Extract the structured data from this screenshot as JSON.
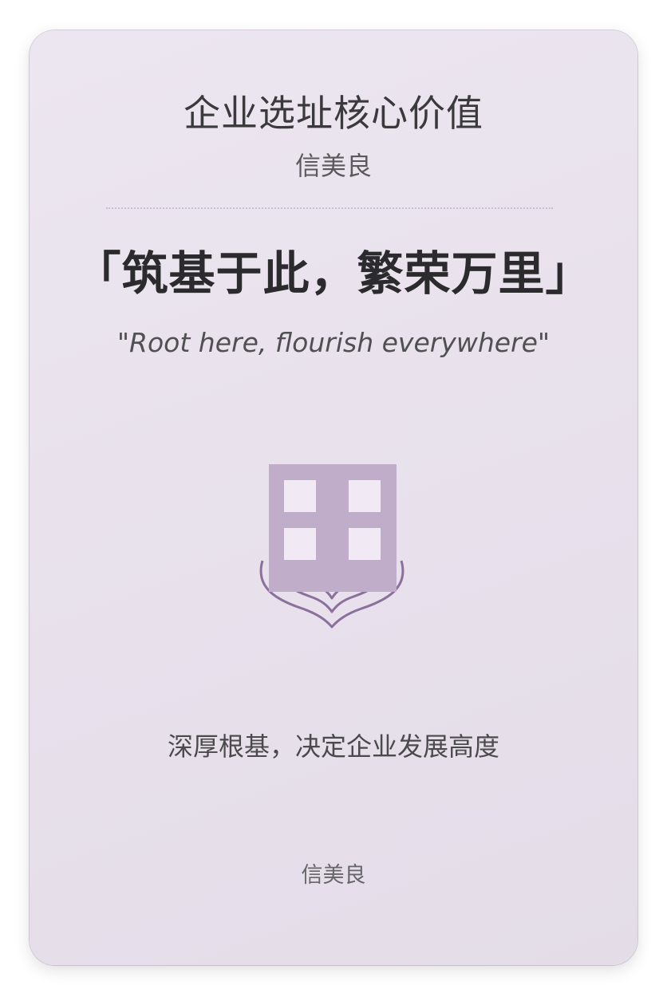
{
  "card": {
    "title": "企业选址核心价值",
    "subtitle": "信美良",
    "slogan": "「筑基于此，繁荣万里」",
    "slogan_en": "\"Root here, flourish everywhere\"",
    "tagline": "深厚根基，决定企业发展高度",
    "footer": "信美良"
  },
  "emblem": {
    "icon": "building-with-roots-icon",
    "building_color": "#bfadc9",
    "window_color": "#f1e9f3",
    "root_color": "#8b6f9d"
  }
}
